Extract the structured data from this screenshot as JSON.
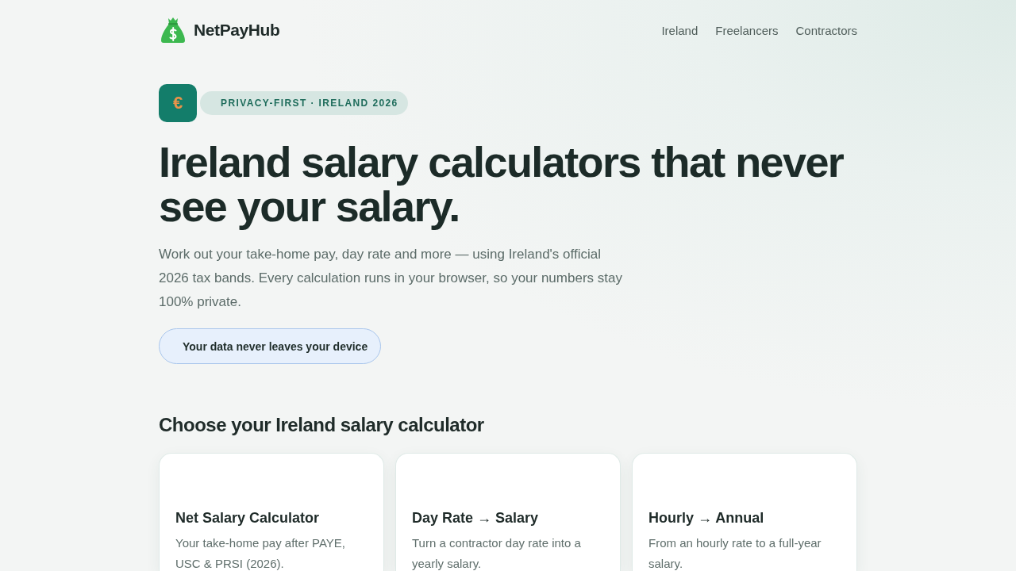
{
  "header": {
    "logo": "NetPayHub",
    "nav": [
      "Ireland",
      "Freelancers",
      "Contractors"
    ]
  },
  "hero": {
    "icon": "€",
    "eyebrow": "PRIVACY-FIRST · IRELAND 2026",
    "title": "Ireland salary calculators that never see your salary.",
    "description": "Work out your take-home pay, day rate and more — using Ireland's official 2026 tax bands. Every calculation runs in your browser, so your numbers stay 100% private.",
    "privacy_button": "Your data never leaves your device"
  },
  "calculators": {
    "heading": "Choose your Ireland salary calculator",
    "cards": [
      {
        "title": "Net Salary Calculator",
        "description": "Your take-home pay after PAYE, USC & PRSI (2026)."
      },
      {
        "title": "Day Rate → Salary",
        "description": "Turn a contractor day rate into a yearly salary."
      },
      {
        "title": "Hourly → Annual",
        "description": "From an hourly rate to a full-year salary."
      }
    ]
  }
}
